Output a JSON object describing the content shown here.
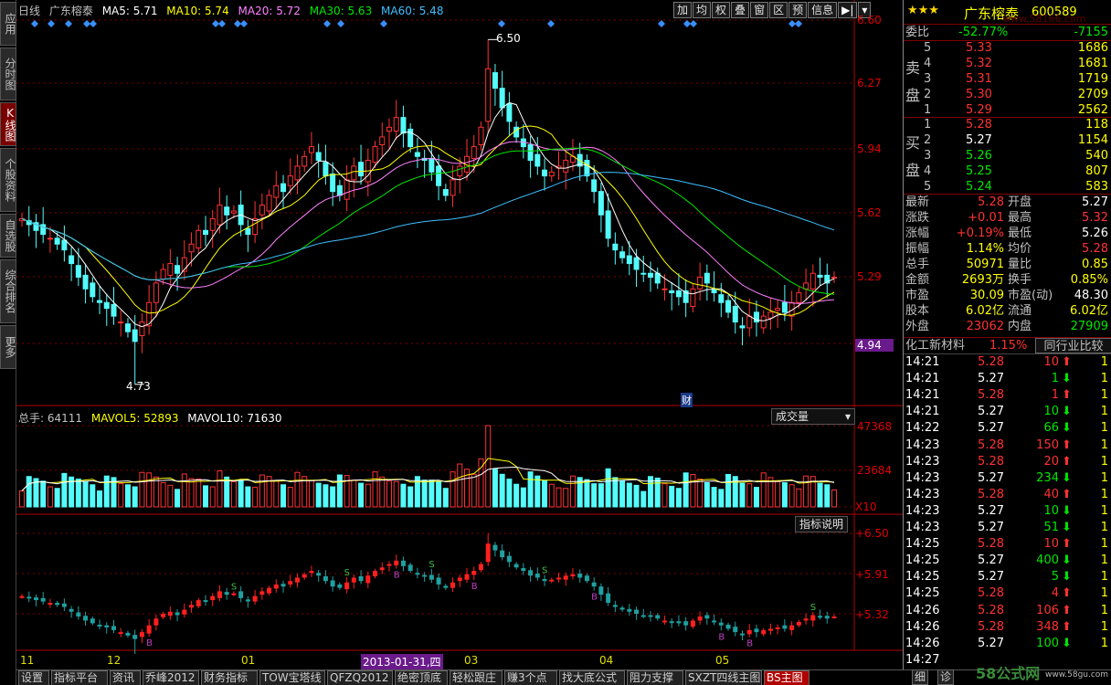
{
  "left_nav": [
    "应用",
    "分时图",
    "K线图",
    "个股资料",
    "自选股",
    "综合排名",
    "更多"
  ],
  "top_info": {
    "period": "日线",
    "stock_name": "广东榕泰",
    "ma5": "MA5: 5.71",
    "ma10": "MA10: 5.74",
    "ma20": "MA20: 5.72",
    "ma30": "MA30: 5.63",
    "ma60": "MA60: 5.48"
  },
  "toolbar": [
    "加",
    "均",
    "权",
    "叠",
    "窗",
    "区",
    "预",
    "信息"
  ],
  "price_axis": [
    "6.60",
    "6.27",
    "5.94",
    "5.62",
    "5.29",
    "4.94"
  ],
  "annotations": {
    "high": "6.50",
    "low": "4.73",
    "fin": "财"
  },
  "volume": {
    "total": "总手: 64111",
    "mavol5": "MAVOL5: 52893",
    "mavol10": "MAVOL10: 71630",
    "select": "成交量",
    "axis": [
      "47368",
      "23684"
    ],
    "unit": "X10"
  },
  "indicator": {
    "select": "指标说明",
    "axis": [
      "+6.50",
      "+5.91",
      "+5.32"
    ]
  },
  "dates": {
    "11": "11",
    "12": "12",
    "1": "01",
    "sel": "2013-01-31,四",
    "3": "03",
    "4": "04",
    "5": "05"
  },
  "quote": {
    "stars": "★★★",
    "name": "广东榕泰",
    "code": "600589",
    "weibi_label": "委比",
    "weibi_pct": "-52.77%",
    "weibi_diff": "-7155",
    "sell_label": [
      "卖",
      "盘"
    ],
    "buy_label": [
      "买",
      "盘"
    ],
    "sells": [
      {
        "lvl": "5",
        "price": "5.33",
        "vol": "1686"
      },
      {
        "lvl": "4",
        "price": "5.32",
        "vol": "1681"
      },
      {
        "lvl": "3",
        "price": "5.31",
        "vol": "1719"
      },
      {
        "lvl": "2",
        "price": "5.30",
        "vol": "2709"
      },
      {
        "lvl": "1",
        "price": "5.29",
        "vol": "2562"
      }
    ],
    "buys": [
      {
        "lvl": "1",
        "price": "5.28",
        "vol": "118"
      },
      {
        "lvl": "2",
        "price": "5.27",
        "vol": "1154"
      },
      {
        "lvl": "3",
        "price": "5.26",
        "vol": "540"
      },
      {
        "lvl": "4",
        "price": "5.25",
        "vol": "807"
      },
      {
        "lvl": "5",
        "price": "5.24",
        "vol": "583"
      }
    ],
    "stats": [
      {
        "l1": "最新",
        "v1": "5.28",
        "l2": "开盘",
        "v2": "5.27"
      },
      {
        "l1": "涨跌",
        "v1": "+0.01",
        "l2": "最高",
        "v2": "5.32"
      },
      {
        "l1": "涨幅",
        "v1": "+0.19%",
        "l2": "最低",
        "v2": "5.26"
      },
      {
        "l1": "振幅",
        "v1": "1.14%",
        "l2": "均价",
        "v2": "5.28"
      },
      {
        "l1": "总手",
        "v1": "50971",
        "l2": "量比",
        "v2": "0.85"
      },
      {
        "l1": "金额",
        "v1": "2693万",
        "l2": "换手",
        "v2": "0.85%"
      },
      {
        "l1": "市盈",
        "v1": "30.09",
        "l2": "市盈(动)",
        "v2": "48.30"
      },
      {
        "l1": "股本",
        "v1": "6.02亿",
        "l2": "流通",
        "v2": "6.02亿"
      },
      {
        "l1": "外盘",
        "v1": "23062",
        "l2": "内盘",
        "v2": "27909"
      }
    ],
    "sector": "化工新材料",
    "sector_pct": "1.15%",
    "peer_btn": "同行业比较",
    "ticks": [
      {
        "t": "14:21",
        "p": "5.28",
        "v": "10",
        "d": "up",
        "n": "1"
      },
      {
        "t": "14:21",
        "p": "5.27",
        "v": "1",
        "d": "down",
        "n": "1"
      },
      {
        "t": "14:21",
        "p": "5.28",
        "v": "1",
        "d": "up",
        "n": "1"
      },
      {
        "t": "14:21",
        "p": "5.27",
        "v": "10",
        "d": "down",
        "n": "1"
      },
      {
        "t": "14:22",
        "p": "5.27",
        "v": "66",
        "d": "down",
        "n": "1"
      },
      {
        "t": "14:23",
        "p": "5.28",
        "v": "150",
        "d": "up",
        "n": "1"
      },
      {
        "t": "14:23",
        "p": "5.28",
        "v": "20",
        "d": "up",
        "n": "1"
      },
      {
        "t": "14:23",
        "p": "5.27",
        "v": "234",
        "d": "down",
        "n": "1"
      },
      {
        "t": "14:23",
        "p": "5.28",
        "v": "40",
        "d": "up",
        "n": "1"
      },
      {
        "t": "14:23",
        "p": "5.27",
        "v": "10",
        "d": "down",
        "n": "1"
      },
      {
        "t": "14:23",
        "p": "5.27",
        "v": "51",
        "d": "down",
        "n": "1"
      },
      {
        "t": "14:25",
        "p": "5.28",
        "v": "10",
        "d": "up",
        "n": "1"
      },
      {
        "t": "14:25",
        "p": "5.27",
        "v": "400",
        "d": "down",
        "n": "1"
      },
      {
        "t": "14:25",
        "p": "5.27",
        "v": "5",
        "d": "down",
        "n": "1"
      },
      {
        "t": "14:25",
        "p": "5.28",
        "v": "4",
        "d": "up",
        "n": "1"
      },
      {
        "t": "14:26",
        "p": "5.28",
        "v": "106",
        "d": "up",
        "n": "1"
      },
      {
        "t": "14:26",
        "p": "5.28",
        "v": "348",
        "d": "up",
        "n": "1"
      },
      {
        "t": "14:26",
        "p": "5.27",
        "v": "100",
        "d": "down",
        "n": "1"
      },
      {
        "t": "14:27",
        "p": "",
        "v": "",
        "d": "",
        "n": ""
      }
    ]
  },
  "bottom_tabs": [
    "设置",
    "指标平台",
    "资讯",
    "乔峰2012",
    "财务指标",
    "TOW宝塔线",
    "QFZQ2012",
    "绝密顶底",
    "轻松跟庄",
    "赚3个点",
    "找大底公式",
    "阻力支撑",
    "SXZT四线主图",
    "BS主图"
  ],
  "bottom_right": [
    "细",
    "诊"
  ],
  "watermark": {
    "cn": "58公式网",
    "url": "www.58gu.com",
    "top": "www.58166.com"
  },
  "colors": {
    "up": "#ff3232",
    "down": "#54fcfc",
    "ma5": "#ffffff",
    "ma10": "#ffff00",
    "ma20": "#ff80ff",
    "ma30": "#00e600",
    "ma60": "#3fbfff",
    "grid": "#800000"
  },
  "chart_data": {
    "type": "candlestick",
    "price_range": [
      4.73,
      6.5
    ],
    "months": [
      "11",
      "12",
      "01",
      "03",
      "04",
      "05"
    ],
    "closes": [
      5.58,
      5.55,
      5.52,
      5.5,
      5.48,
      5.45,
      5.42,
      5.35,
      5.28,
      5.22,
      5.18,
      5.15,
      5.12,
      5.08,
      5.05,
      5.0,
      4.95,
      5.05,
      5.15,
      5.25,
      5.32,
      5.35,
      5.3,
      5.38,
      5.45,
      5.52,
      5.5,
      5.58,
      5.65,
      5.6,
      5.62,
      5.55,
      5.5,
      5.58,
      5.65,
      5.7,
      5.75,
      5.72,
      5.8,
      5.85,
      5.9,
      5.95,
      5.88,
      5.8,
      5.72,
      5.7,
      5.78,
      5.85,
      5.8,
      5.88,
      5.95,
      6.0,
      6.05,
      6.1,
      6.02,
      5.95,
      5.9,
      5.88,
      5.82,
      5.75,
      5.7,
      5.78,
      5.85,
      5.9,
      5.95,
      6.05,
      6.35,
      6.25,
      6.15,
      6.08,
      6.0,
      5.95,
      5.88,
      5.85,
      5.8,
      5.82,
      5.85,
      5.88,
      5.9,
      5.85,
      5.8,
      5.72,
      5.6,
      5.48,
      5.42,
      5.38,
      5.35,
      5.32,
      5.3,
      5.28,
      5.25,
      5.22,
      5.2,
      5.18,
      5.15,
      5.22,
      5.28,
      5.25,
      5.2,
      5.15,
      5.1,
      5.05,
      5.02,
      5.08,
      5.05,
      5.08,
      5.1,
      5.12,
      5.1,
      5.15,
      5.2,
      5.25,
      5.3,
      5.28,
      5.25,
      5.28
    ]
  }
}
